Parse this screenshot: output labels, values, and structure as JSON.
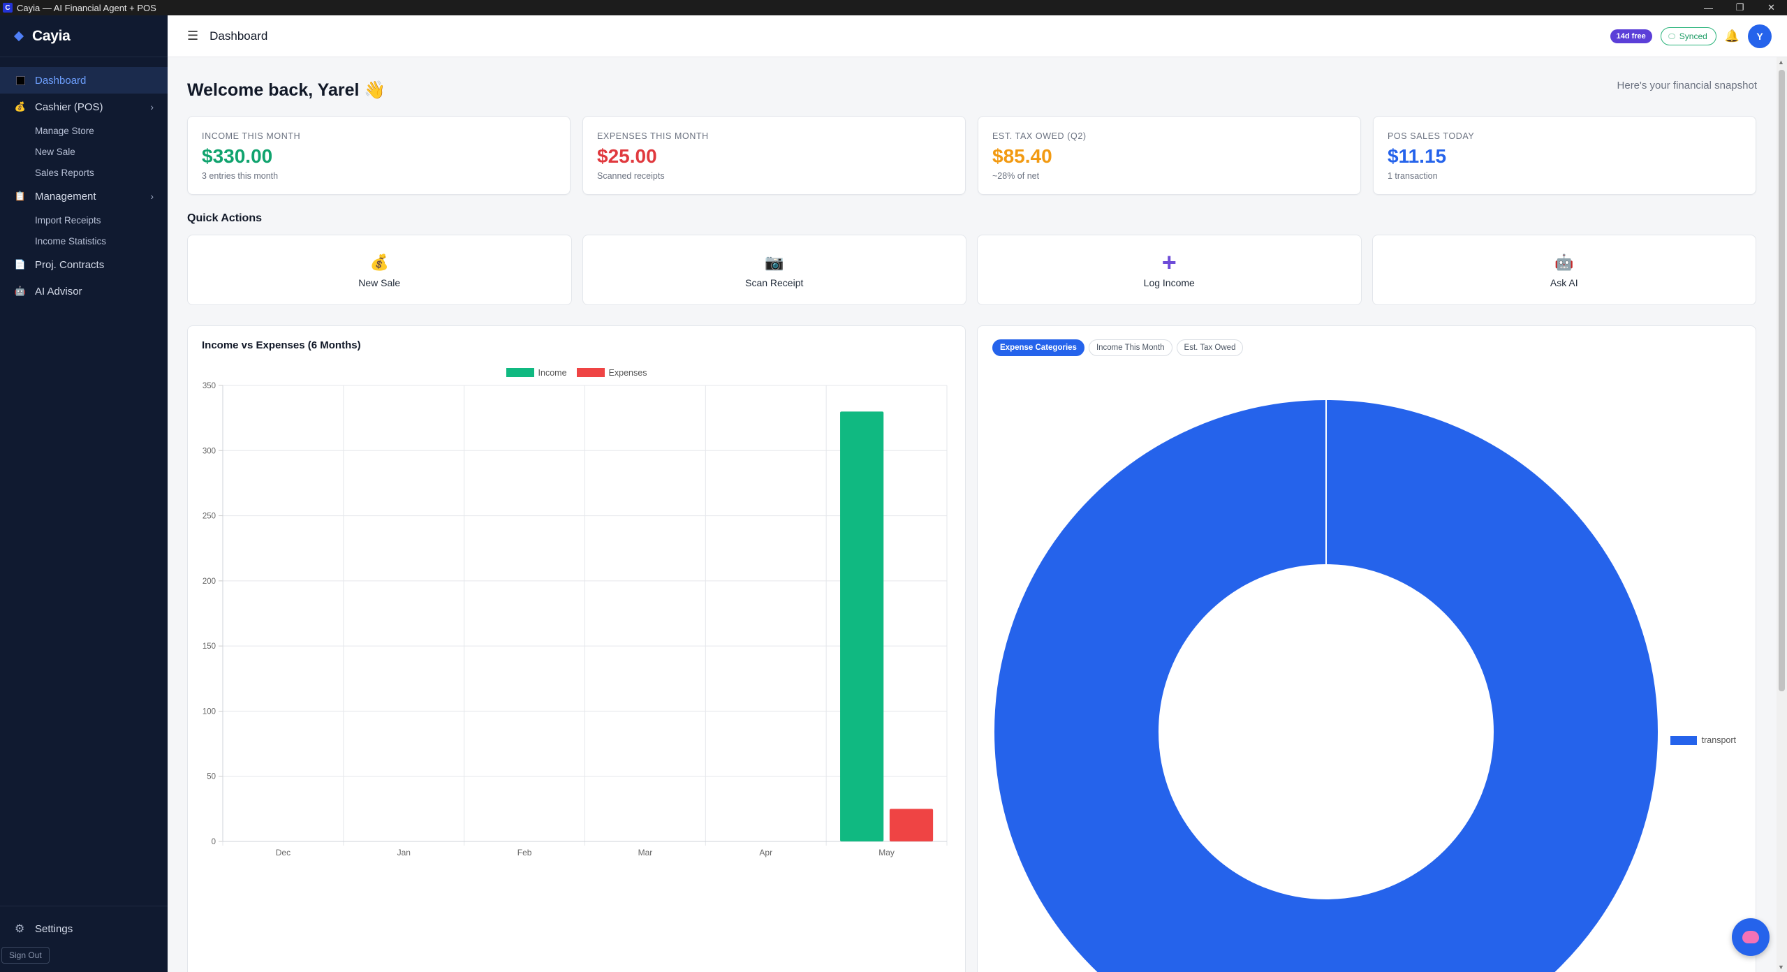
{
  "window": {
    "title": "Cayia — AI Financial Agent + POS",
    "icon_letter": "C"
  },
  "sidebar": {
    "brand": "Cayia",
    "items": [
      {
        "label": "Dashboard",
        "icon": "square-icon",
        "active": true
      },
      {
        "label": "Cashier (POS)",
        "icon": "money-bag-icon",
        "expandable": true
      },
      {
        "label": "Manage Store",
        "sub": true
      },
      {
        "label": "New Sale",
        "sub": true
      },
      {
        "label": "Sales Reports",
        "sub": true
      },
      {
        "label": "Management",
        "icon": "clipboard-icon",
        "expandable": true
      },
      {
        "label": "Import Receipts",
        "sub": true
      },
      {
        "label": "Income Statistics",
        "sub": true
      },
      {
        "label": "Proj. Contracts",
        "icon": "document-icon"
      },
      {
        "label": "AI Advisor",
        "icon": "robot-icon"
      }
    ],
    "settings": "Settings",
    "sign_out": "Sign Out"
  },
  "header": {
    "title": "Dashboard",
    "trial_badge": "14d free",
    "sync_status": "Synced"
  },
  "avatar_initial": "Y",
  "welcome": "Welcome back, Yarel 👋",
  "snapshot_note": "Here's your financial snapshot",
  "kpis": [
    {
      "label": "INCOME THIS MONTH",
      "value": "$330.00",
      "sub": "3 entries this month",
      "color": "#10a36e"
    },
    {
      "label": "EXPENSES THIS MONTH",
      "value": "$25.00",
      "sub": "Scanned receipts",
      "color": "#e0393e"
    },
    {
      "label": "EST. TAX OWED (Q2)",
      "value": "$85.40",
      "sub": "~28% of net",
      "color": "#f29a12"
    },
    {
      "label": "POS SALES TODAY",
      "value": "$11.15",
      "sub": "1 transaction",
      "color": "#2563eb"
    }
  ],
  "quick_actions": {
    "title": "Quick Actions",
    "items": [
      {
        "label": "New Sale",
        "icon": "💰"
      },
      {
        "label": "Scan Receipt",
        "icon": "📷"
      },
      {
        "label": "Log Income",
        "icon": "+"
      },
      {
        "label": "Ask AI",
        "icon": "🤖"
      }
    ]
  },
  "income_chart": {
    "title": "Income vs Expenses (6 Months)"
  },
  "donut_tabs": [
    "Expense Categories",
    "Income This Month",
    "Est. Tax Owed"
  ],
  "chart_data": [
    {
      "type": "bar",
      "title": "Income vs Expenses (6 Months)",
      "categories": [
        "Dec",
        "Jan",
        "Feb",
        "Mar",
        "Apr",
        "May"
      ],
      "series": [
        {
          "name": "Income",
          "color": "#10b981",
          "values": [
            0,
            0,
            0,
            0,
            0,
            330
          ]
        },
        {
          "name": "Expenses",
          "color": "#ef4444",
          "values": [
            0,
            0,
            0,
            0,
            0,
            25
          ]
        }
      ],
      "ylim": [
        0,
        350
      ],
      "yticks": [
        0,
        50,
        100,
        150,
        200,
        250,
        300,
        350
      ],
      "grid": true,
      "legend": "top-center"
    },
    {
      "type": "pie",
      "variant": "donut",
      "labels": [
        "transport"
      ],
      "values": [
        25
      ],
      "colors": [
        "#2563eb"
      ],
      "legend": "right"
    }
  ]
}
